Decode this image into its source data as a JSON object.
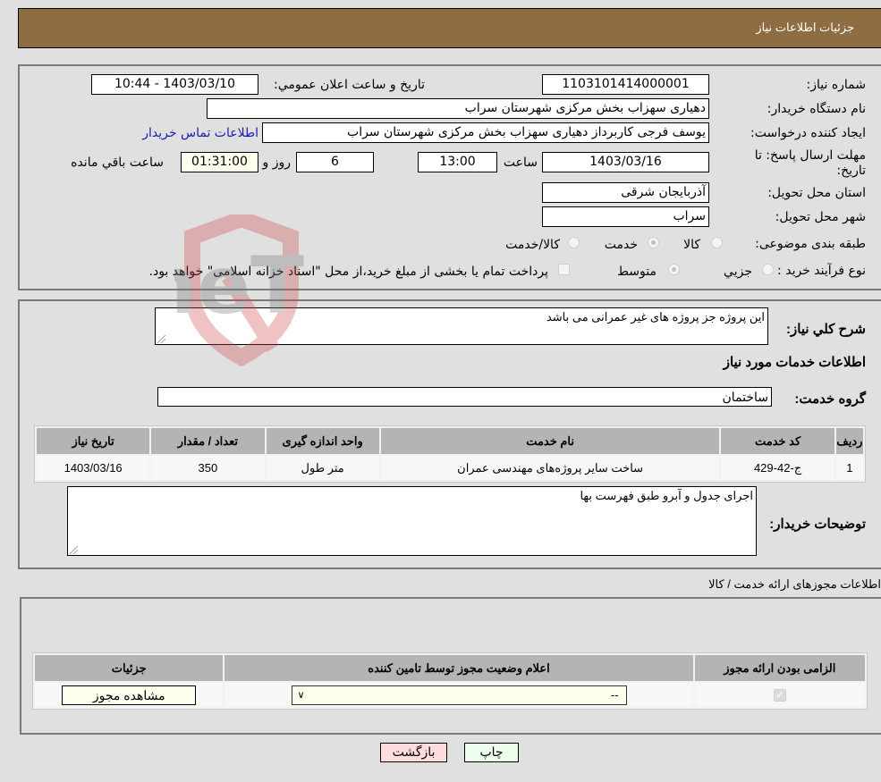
{
  "header": {
    "title": "جزئیات اطلاعات نیاز"
  },
  "details": {
    "need_number_label": "شماره نیاز:",
    "need_number": "1103101414000001",
    "announce_label": "تاريخ و ساعت اعلان عمومي:",
    "announce_value": "1403/03/10 - 10:44",
    "buyer_org_label": "نام دستگاه خریدار:",
    "buyer_org": "دهیاری سهزاب بخش مرکزی شهرستان سراب",
    "requester_label": "ایجاد کننده درخواست:",
    "requester": "یوسف فرجی کاربرداز دهیاری سهزاب بخش مرکزی شهرستان سراب",
    "contact_link": "اطلاعات تماس خریدار",
    "deadline_label": "مهلت ارسال پاسخ: تا تاریخ:",
    "deadline_date": "1403/03/16",
    "time_label": "ساعت",
    "deadline_time": "13:00",
    "days_value": "6",
    "days_label": "روز و",
    "remaining_time": "01:31:00",
    "remaining_label": "ساعت باقي مانده",
    "province_label": "استان محل تحویل:",
    "province": "آذربایجان شرقی",
    "city_label": "شهر محل تحویل:",
    "city": "سراب",
    "category_label": "طبقه بندی موضوعی:",
    "category_options": [
      {
        "label": "کالا",
        "checked": false
      },
      {
        "label": "خدمت",
        "checked": true
      },
      {
        "label": "کالا/خدمت",
        "checked": false
      }
    ],
    "process_label": "نوع فرآیند خرید :",
    "process_options": [
      {
        "label": "جزيي",
        "checked": false
      },
      {
        "label": "متوسط",
        "checked": true
      }
    ],
    "treasury_note": "پرداخت تمام یا بخشی از مبلغ خرید،از محل \"اسناد خزانه اسلامی\" خواهد بود."
  },
  "description": {
    "label": "شرح کلي نياز:",
    "value": "این پروژه جز پروژه های غیر عمرانی می باشد",
    "services_heading": "اطلاعات خدمات مورد نياز",
    "service_group_label": "گروه خدمت:",
    "service_group": "ساختمان"
  },
  "services_table": {
    "headers": [
      "ردیف",
      "کد خدمت",
      "نام خدمت",
      "واحد اندازه گیری",
      "تعداد / مقدار",
      "تاریخ نیاز"
    ],
    "rows": [
      [
        "1",
        "ج-42-429",
        "ساخت سایر پروژه‌های مهندسی عمران",
        "متر طول",
        "350",
        "1403/03/16"
      ]
    ]
  },
  "buyer_notes": {
    "label": "توضيحات خريدار:",
    "value": "اجرای جدول و آبرو طبق فهرست بها"
  },
  "permits": {
    "section_title": "اطلاعات مجوزهای ارائه خدمت / کالا",
    "headers": [
      "الزامی بودن ارائه مجوز",
      "اعلام وضعیت مجوز توسط تامین کننده",
      "جزئیات"
    ],
    "row": {
      "required_checked": true,
      "status_select": "--",
      "view_button": "مشاهده مجوز"
    }
  },
  "footer": {
    "print_button": "چاپ",
    "back_button": "بازگشت"
  },
  "watermark": {
    "text": "AriaTender.neT"
  },
  "colors": {
    "header_bg": "#8f6d42",
    "print_bg": "#eeffee",
    "back_bg": "#ffdddd",
    "link": "#1a1ab4"
  }
}
